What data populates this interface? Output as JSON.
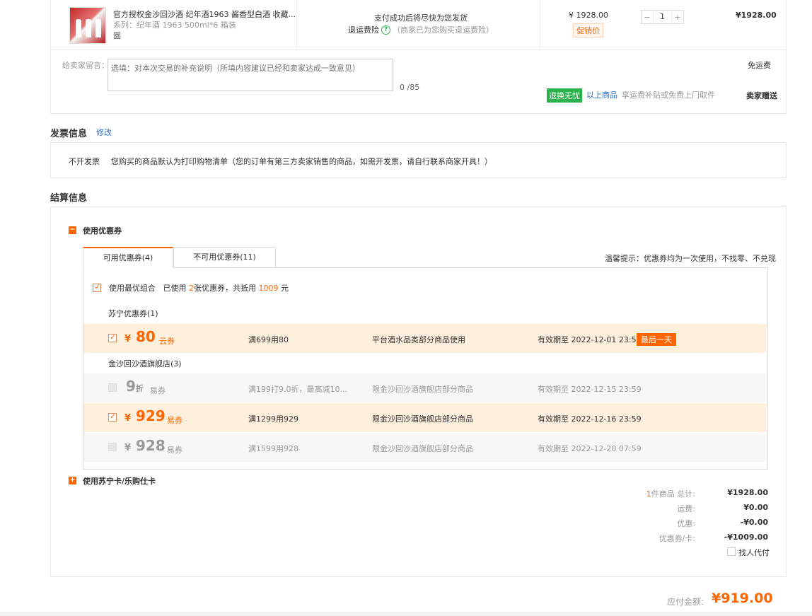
{
  "product": {
    "title": "官方授权金沙回沙酒 纪年酒1963 酱香型白酒 收藏...",
    "spec": "系列：纪年酒 1963 500ml*6 箱装",
    "badge": "圜",
    "ship_note": "支付成功后将尽快为您发货",
    "return_insurance_label": "退运费险",
    "return_insurance_note": "（商家已为您购买退运费险）",
    "unit_price": "¥ 1928.00",
    "promo_tag": "促销价",
    "qty": "1",
    "qty_minus": "−",
    "qty_plus": "+",
    "subtotal": "¥1928.00"
  },
  "message": {
    "label": "给卖家留言：",
    "placeholder": "选填：对本次交易的补充说明（所填内容建议已经和卖家达成一致意见）",
    "counter": "0 /85",
    "shipping_fee": "免运费",
    "return_tag": "退换无忧",
    "return_link": "以上商品",
    "return_text": "享运费补贴或免费上门取件",
    "gift": "卖家赠送"
  },
  "invoice": {
    "title": "发票信息",
    "edit": "修改",
    "type": "不开发票",
    "desc": "您购买的商品默认为打印购物清单（您的订单有第三方卖家销售的商品，如需开发票，请自行联系商家开具！）"
  },
  "settlement": {
    "title": "结算信息",
    "use_coupon": "使用优惠券",
    "tabs": [
      {
        "label": "可用优惠券(4)"
      },
      {
        "label": "不可用优惠券(11)"
      }
    ],
    "tip": "温馨提示：优惠券均为一次使用，不找零、不兑现",
    "optimal": {
      "label": "使用最优组合",
      "text_prefix": "已使用",
      "count": "2",
      "text_mid": "张优惠券，共抵用",
      "amount": "1009",
      "text_suffix": "元"
    },
    "group1": "苏宁优惠券(1)",
    "group2": "金沙回沙酒旗舰店(3)",
    "coupons": [
      {
        "yen": "¥",
        "amount": "80",
        "unit": "",
        "type": "云券",
        "rule": "满699用80",
        "scope": "平台酒水品类部分商品使用",
        "expire": "有效期至 2022-12-01 23:59",
        "tag": "最后一天"
      },
      {
        "yen": "",
        "amount": "9",
        "unit": "折",
        "type": "易券",
        "rule": "满199打9.0折，最高减10...",
        "scope": "限金沙回沙酒旗舰店部分商品",
        "expire": "有效期至 2022-12-15 23:59"
      },
      {
        "yen": "¥",
        "amount": "929",
        "unit": "",
        "type": "易券",
        "rule": "满1299用929",
        "scope": "限金沙回沙酒旗舰店部分商品",
        "expire": "有效期至 2022-12-16 23:59"
      },
      {
        "yen": "¥",
        "amount": "928",
        "unit": "",
        "type": "易券",
        "rule": "满1599用928",
        "scope": "限金沙回沙酒旗舰店部分商品",
        "expire": "有效期至 2022-12-20 07:59"
      }
    ],
    "use_card": "使用苏宁卡/乐购仕卡"
  },
  "summary": {
    "count": "1",
    "total_label": "件商品 总计:",
    "total": "¥1928.00",
    "shipping_label": "运费:",
    "shipping": "¥0.00",
    "discount_label": "优惠:",
    "discount": "-¥0.00",
    "coupon_label": "优惠券/卡:",
    "coupon": "-¥1009.00",
    "proxy_pay": "找人代付",
    "payable_label": "应付金额:",
    "payable": "¥919.00"
  },
  "colors": {
    "accent": "#ff6600",
    "green": "#2bb24c",
    "link": "#2a6fc9",
    "selected_row": "#fef0dd"
  }
}
